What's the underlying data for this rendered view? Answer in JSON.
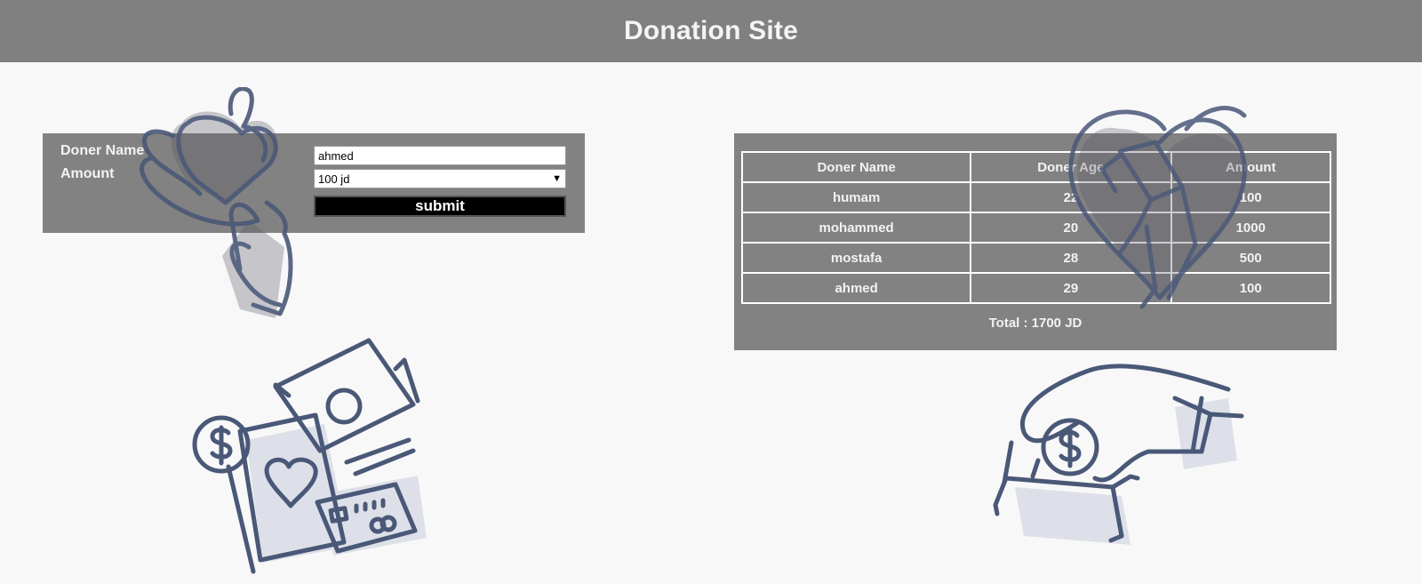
{
  "header": {
    "title": "Donation Site"
  },
  "form": {
    "name_label": "Doner Name",
    "amount_label": "Amount",
    "name_value": "ahmed",
    "amount_selected": "100 jd",
    "submit_label": "submit"
  },
  "table": {
    "columns": [
      "Doner Name",
      "Doner Age",
      "Amount"
    ],
    "rows": [
      [
        "humam",
        "22",
        "100"
      ],
      [
        "mohammed",
        "20",
        "1000"
      ],
      [
        "mostafa",
        "28",
        "500"
      ],
      [
        "ahmed",
        "29",
        "100"
      ]
    ],
    "total": "Total : 1700 JD"
  },
  "illustrations": {
    "top_left": "hands-holding-heart-icon",
    "bottom_left": "money-and-card-icon",
    "top_right": "heart-ribbon-icon",
    "bottom_right": "hand-dropping-coin-icon"
  },
  "colors": {
    "header_bg": "#808080",
    "panel_bg": "#808080",
    "page_bg": "#f8f8f8",
    "icon_stroke": "#4a5878",
    "icon_shadow": "#dde0e8"
  }
}
